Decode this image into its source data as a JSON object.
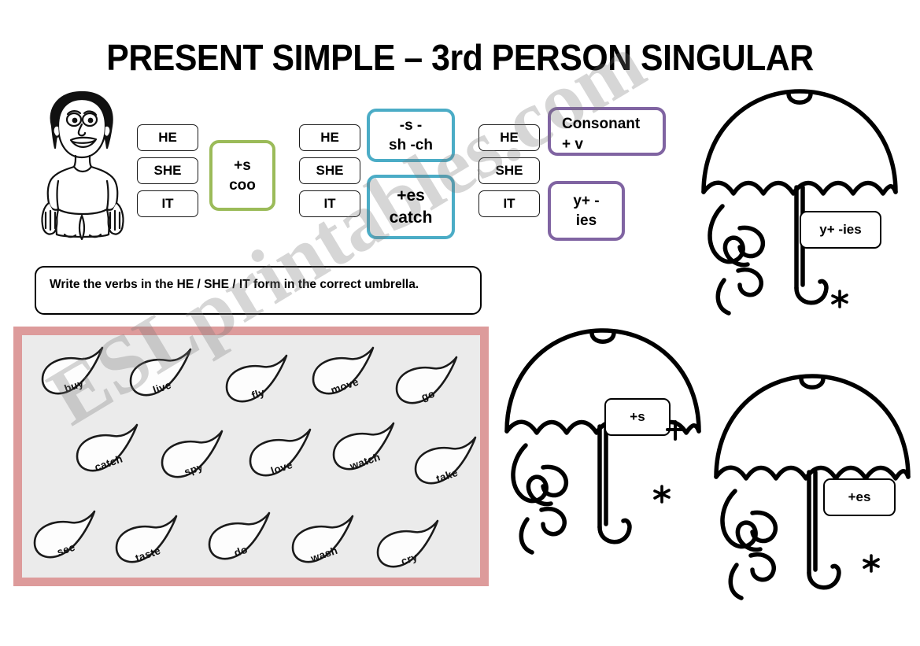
{
  "page": {
    "title": "PRESENT SIMPLE – 3rd PERSON SINGULAR",
    "watermark": "ESLprintables.com",
    "background": "#ffffff"
  },
  "colors": {
    "green": "#9bbb59",
    "teal": "#4bacc6",
    "purple": "#8064a2",
    "pink_border": "#dd9b9b",
    "panel_fill": "#ebebeb",
    "ink": "#000000"
  },
  "pronouns": [
    "HE",
    "SHE",
    "IT"
  ],
  "rule_groups": [
    {
      "name": "group-s",
      "accent": "#9bbb59",
      "pronouns": [
        "HE",
        "SHE",
        "IT"
      ],
      "rules": [
        {
          "lines": [
            "+s",
            "coo"
          ]
        }
      ]
    },
    {
      "name": "group-es",
      "accent": "#4bacc6",
      "pronouns": [
        "HE",
        "SHE",
        "IT"
      ],
      "rules": [
        {
          "lines": [
            "-s     -",
            "sh -ch"
          ]
        },
        {
          "lines": [
            "+es",
            "catch"
          ]
        }
      ]
    },
    {
      "name": "group-ies",
      "accent": "#8064a2",
      "pronouns": [
        "HE",
        "SHE",
        "IT"
      ],
      "rules": [
        {
          "lines": [
            "Consonant",
            "+ v"
          ]
        },
        {
          "lines": [
            "y+ -",
            "ies"
          ]
        }
      ]
    }
  ],
  "instruction": {
    "text": "Write the verbs in the HE / SHE / IT form in the correct umbrella."
  },
  "raindrops": {
    "rows": [
      [
        "buy",
        "live",
        "fly",
        "move",
        "go"
      ],
      [
        "catch",
        "spy",
        "love",
        "watch",
        "take"
      ],
      [
        "see",
        "taste",
        "do",
        "wash",
        "cry"
      ]
    ],
    "all_verbs": [
      "buy",
      "live",
      "fly",
      "move",
      "go",
      "catch",
      "spy",
      "love",
      "watch",
      "take",
      "see",
      "taste",
      "do",
      "wash",
      "cry"
    ]
  },
  "umbrellas": [
    {
      "name": "umbrella-ies",
      "label": "y+ -ies"
    },
    {
      "name": "umbrella-s",
      "label": "+s"
    },
    {
      "name": "umbrella-es",
      "label": "+es"
    }
  ]
}
